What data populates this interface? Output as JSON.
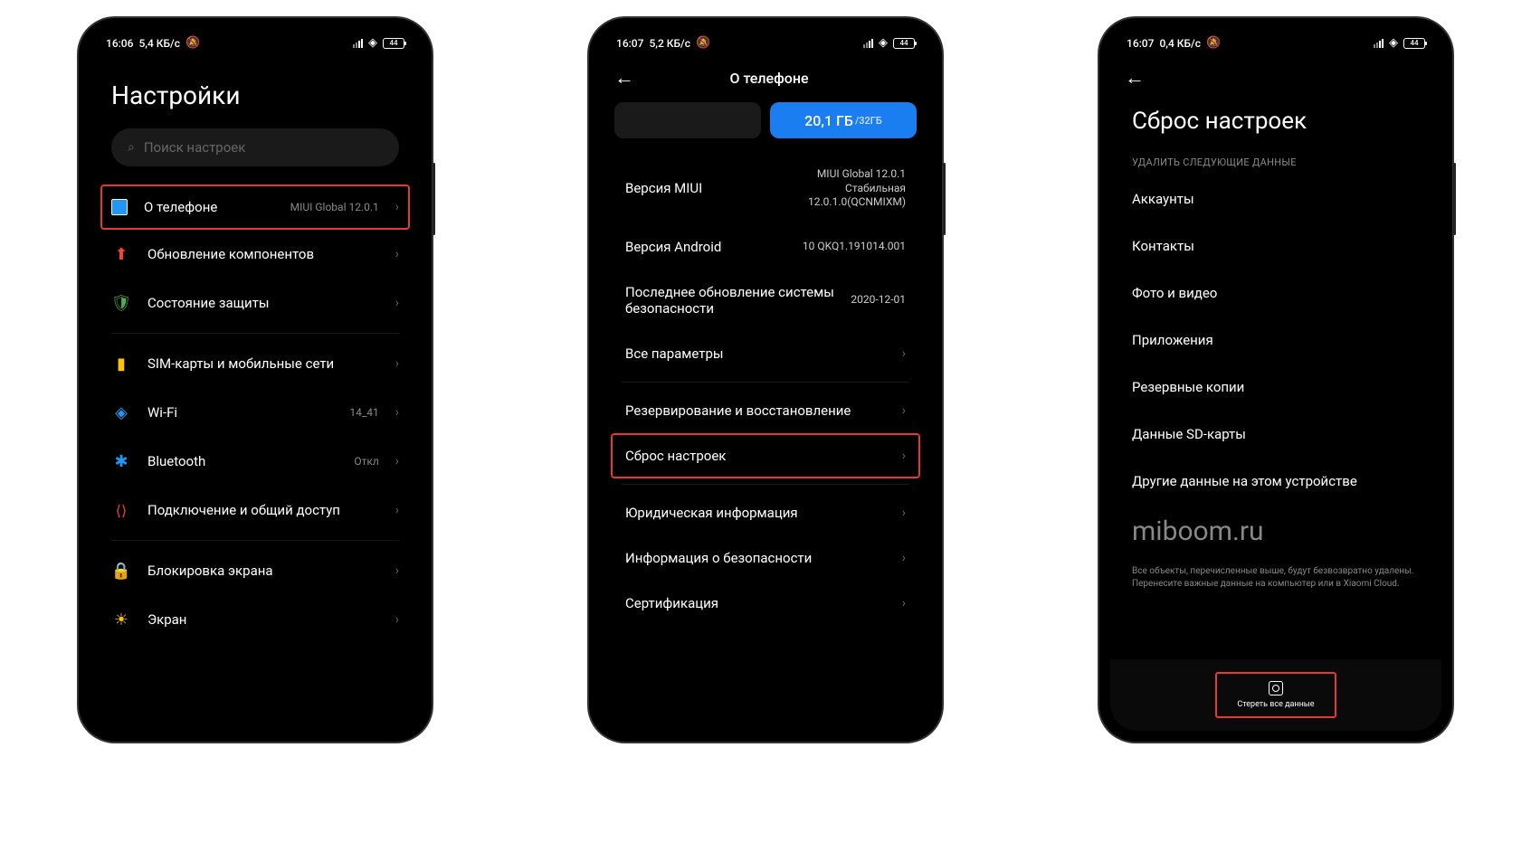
{
  "phone1": {
    "status": {
      "time": "16:06",
      "speed": "5,4 КБ/с",
      "battery": "44"
    },
    "title": "Настройки",
    "search_placeholder": "Поиск настроек",
    "items": [
      {
        "label": "О телефоне",
        "value": "MIUI Global 12.0.1"
      },
      {
        "label": "Обновление компонентов"
      },
      {
        "label": "Состояние защиты"
      },
      {
        "label": "SIM-карты и мобильные сети"
      },
      {
        "label": "Wi-Fi",
        "value": "14_41"
      },
      {
        "label": "Bluetooth",
        "value": "Откл"
      },
      {
        "label": "Подключение и общий доступ"
      },
      {
        "label": "Блокировка экрана"
      },
      {
        "label": "Экран"
      }
    ]
  },
  "phone2": {
    "status": {
      "time": "16:07",
      "speed": "5,2 КБ/с",
      "battery": "44"
    },
    "header": "О телефоне",
    "storage": {
      "used": "20,1 ГБ",
      "total": "/32ГБ"
    },
    "rows": [
      {
        "label": "Версия MIUI",
        "value": "MIUI Global 12.0.1\nСтабильная\n12.0.1.0(QCNMIXM)"
      },
      {
        "label": "Версия Android",
        "value": "10 QKQ1.191014.001"
      },
      {
        "label": "Последнее обновление системы безопасности",
        "value": "2020-12-01"
      },
      {
        "label": "Все параметры"
      },
      {
        "label": "Резервирование и восстановление"
      },
      {
        "label": "Сброс настроек"
      },
      {
        "label": "Юридическая информация"
      },
      {
        "label": "Информация о безопасности"
      },
      {
        "label": "Сертификация"
      }
    ]
  },
  "phone3": {
    "status": {
      "time": "16:07",
      "speed": "0,4 КБ/с",
      "battery": "44"
    },
    "title": "Сброс настроек",
    "section": "УДАЛИТЬ СЛЕДУЮЩИЕ ДАННЫЕ",
    "items": [
      "Аккаунты",
      "Контакты",
      "Фото и видео",
      "Приложения",
      "Резервные копии",
      "Данные SD-карты",
      "Другие данные на этом устройстве"
    ],
    "watermark": "miboom.ru",
    "disclaimer": "Все объекты, перечисленные выше, будут безвозвратно удалены. Перенесите важные данные на компьютер или в Xiaomi Cloud.",
    "erase": "Стереть все данные"
  }
}
